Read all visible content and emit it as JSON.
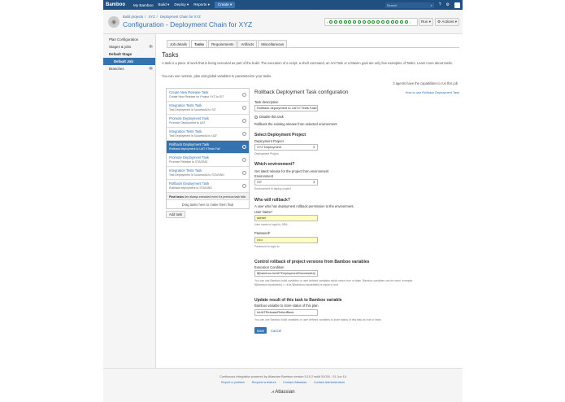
{
  "topbar": {
    "logo": "Bamboo",
    "nav": [
      "My Bamboo",
      "Build ▾",
      "Deploy ▾",
      "Reports ▾"
    ],
    "create": "Create ▾",
    "search_placeholder": "Search"
  },
  "header": {
    "breadcrumbs": [
      "Build projects",
      "XYZ",
      "Deployment Chain for XYZ"
    ],
    "title": "Configuration - Deployment Chain for XYZ",
    "run_label": "Run ▾",
    "actions_label": "Actions ▾"
  },
  "sidebar": {
    "items": [
      {
        "label": "Plan Configuration"
      },
      {
        "label": "Stages & jobs",
        "count": "1"
      },
      {
        "label": "Default Stage"
      },
      {
        "label": "Default Job"
      },
      {
        "label": "Branches",
        "count": "0"
      }
    ]
  },
  "tabs": [
    "Job details",
    "Tasks",
    "Requirements",
    "Artifacts",
    "Miscellaneous"
  ],
  "main": {
    "heading": "Tasks",
    "intro": "A task is a piece of work that is being executed as part of the build. The execution of a script, a shell command, an Ant Task or a Maven goal are only few examples of Tasks. Learn more about tasks.",
    "intro2": "You can use runtime, plan and global variables to parameterize your tasks.",
    "agents": "3 agents have the capabilities to run this job"
  },
  "tasks": [
    {
      "name": "Create New Release Task",
      "desc": "Create New Release for Project XYZ to SIT"
    },
    {
      "name": "Integration Tests Task",
      "desc": "Test Deployment is Successful to SIT"
    },
    {
      "name": "Promote Deployment Task",
      "desc": "Promote Deployment to UAT"
    },
    {
      "name": "Integration Tests Task",
      "desc": "Test Deployment is Successful to UAT"
    },
    {
      "name": "Rollback Deployment Task",
      "desc": "Rollback deployment to UAT if Tests Fail",
      "active": true
    },
    {
      "name": "Promote Deployment Task",
      "desc": "Promote Release to STAGING"
    },
    {
      "name": "Integration Tests Task",
      "desc": "Test Deployment is Successful to STAGING"
    },
    {
      "name": "Rollback Deployment Task",
      "desc": "Rollback deployment to STAGING"
    }
  ],
  "final_tasks": {
    "label": "Final tasks",
    "desc": "Are always executed even if a previous task fails"
  },
  "drag_hint": "Drag tasks here to make them final",
  "add_task": "Add task",
  "form": {
    "title": "Rollback Deployment Task configuration",
    "howto": "How to use Rollback Deployment Task",
    "task_desc_label": "Task description",
    "task_desc_value": "Rollback deployment to UAT if Tests Failes",
    "disable_label": "Disable this task",
    "rollback_note": "Rollback the existing release from selected environment",
    "sec_project": "Select Deployment Project",
    "project_label": "Deployment Project",
    "project_value": "XYZ Deployment",
    "project_hint": "Deployment Project",
    "sec_env": "Which environment?",
    "env_note": "Get latest release for the project from environment",
    "env_label": "Environment",
    "env_value": "SIT",
    "env_hint": "Environment to deploy project",
    "sec_who": "Who will rollback?",
    "who_note": "A user who has deployment rollback permission to the environment.",
    "user_label": "User Name*",
    "user_value": "admin",
    "user_hint": "User name to login to JIRA",
    "pass_label": "Password*",
    "pass_value": "•••••",
    "pass_hint": "Password to login to",
    "sec_control": "Control rollback of project versions from Bamboo variables",
    "exec_label": "Execution Condition",
    "exec_value": "${bamboo.isUATDeploymentSuccessful}",
    "exec_hint1": "You can use Bamboo build variables or user defined variables which return true or false. Bamboo variables can be used. example:",
    "exec_hint2": "${bamboo.myvariable} == true,${bamboo.myvariable} is equal to true",
    "sec_update": "Update result of this task to Bamboo variable",
    "var_label": "Bamboo variable to store status of this plan",
    "var_value": "isUATReleaseRolledBack",
    "var_hint": "You can use Bamboo build variables or user defined variables to store status of this task as true or false.",
    "save": "Save",
    "cancel": "Cancel"
  },
  "footer": {
    "line1": "Continuous integration powered by Atlassian Bamboo version 5.10.2 build 51016 - 01 Jun 16",
    "links": [
      "Report a problem",
      "Request a feature",
      "Contact Atlassian",
      "Contact Administrators"
    ],
    "brand": "Atlassian"
  }
}
